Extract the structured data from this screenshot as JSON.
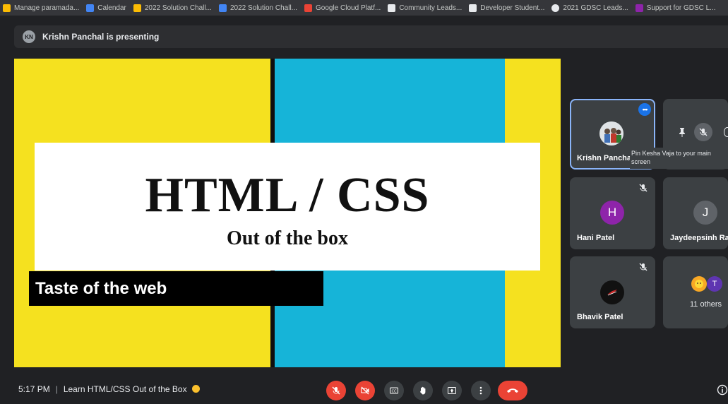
{
  "bookmarks": [
    {
      "label": "Manage paramada...",
      "color": "#fbbc04"
    },
    {
      "label": "Calendar",
      "color": "#4285f4"
    },
    {
      "label": "2022 Solution Chall...",
      "color": "#fbbc04"
    },
    {
      "label": "2022 Solution Chall...",
      "color": "#4285f4"
    },
    {
      "label": "Google Cloud Platf...",
      "color": "#ea4335"
    },
    {
      "label": "Community Leads...",
      "color": "#e8eaed"
    },
    {
      "label": "Developer Student...",
      "color": "#e8eaed"
    },
    {
      "label": "2021 GDSC Leads...",
      "color": "#e8eaed"
    },
    {
      "label": "Support for GDSC L...",
      "color": "#8e24aa"
    }
  ],
  "presenting": {
    "avatar_text": "KN",
    "text": "Krishn Panchal is presenting"
  },
  "slide": {
    "title": "HTML / CSS",
    "subtitle": "Out of the box",
    "tagline": "Taste of the web",
    "colors": {
      "yellow": "#f5e11f",
      "blue": "#16b4d8",
      "black": "#0f0f0f"
    }
  },
  "tiles": {
    "krishn": {
      "name": "Krishn Pancha",
      "more_label": "•••"
    },
    "kesha": {
      "tooltip": "Pin Kesha Vaja to your main screen"
    },
    "hani": {
      "name": "Hani Patel",
      "initial": "H",
      "color": "#8e24aa"
    },
    "jaydeep": {
      "name": "Jaydeepsinh Ra",
      "initial": "J",
      "color": "#5f6368"
    },
    "bhavik": {
      "name": "Bhavik Patel"
    },
    "others": {
      "label": "11 others",
      "initial": "T",
      "color": "#5e35b1"
    }
  },
  "bottom": {
    "time": "5:17 PM",
    "meeting_title": "Learn HTML/CSS Out of the Box",
    "controls": [
      "mic-off",
      "camera-off",
      "captions",
      "raise-hand",
      "present",
      "more-options",
      "leave-call"
    ]
  }
}
